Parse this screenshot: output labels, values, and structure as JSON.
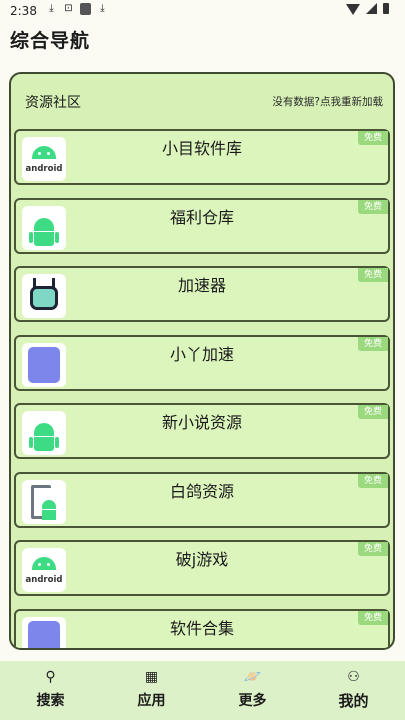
{
  "status_bar": {
    "time": "2:38",
    "left_icons": [
      "download-icon",
      "media-icon",
      "app-icon",
      "download-icon"
    ],
    "right_icons": [
      "wifi-icon",
      "signal-icon",
      "battery-icon"
    ]
  },
  "page": {
    "title": "综合导航"
  },
  "panel": {
    "title": "资源社区",
    "reload_text": "没有数据?点我重新加载"
  },
  "apps": [
    {
      "name": "小目软件库",
      "badge": "免费",
      "icon": "android-logo-icon"
    },
    {
      "name": "福利仓库",
      "badge": "免费",
      "icon": "android-robot-icon"
    },
    {
      "name": "加速器",
      "badge": "免费",
      "icon": "speed-robot-icon"
    },
    {
      "name": "小丫加速",
      "badge": "免费",
      "icon": "purple-android-icon"
    },
    {
      "name": "新小说资源",
      "badge": "免费",
      "icon": "android-robot-icon"
    },
    {
      "name": "白鸽资源",
      "badge": "免费",
      "icon": "gray-frame-android-icon"
    },
    {
      "name": "破j游戏",
      "badge": "免费",
      "icon": "android-logo-icon"
    },
    {
      "name": "软件合集",
      "badge": "免费",
      "icon": "purple-android-icon"
    }
  ],
  "android_logo_text": "android",
  "bottom_nav": [
    {
      "label": "搜索",
      "icon": "search-icon",
      "active": false
    },
    {
      "label": "应用",
      "icon": "apps-grid-icon",
      "active": false
    },
    {
      "label": "更多",
      "icon": "planet-icon",
      "active": false
    },
    {
      "label": "我的",
      "icon": "person-icon",
      "active": true
    }
  ],
  "colors": {
    "card_bg": "#dcf5bc",
    "panel_bg": "#d6f0b6",
    "badge_bg": "#9bd97e",
    "nav_bg": "#dcf1c7"
  }
}
